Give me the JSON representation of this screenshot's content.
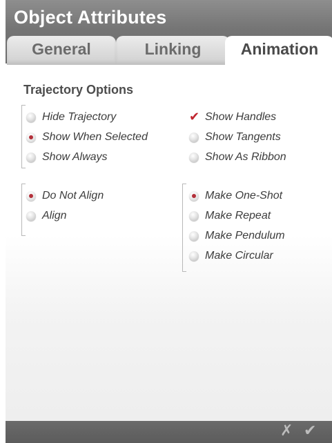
{
  "window": {
    "title": "Object Attributes"
  },
  "tabs": [
    {
      "label": "General",
      "active": false
    },
    {
      "label": "Linking",
      "active": false
    },
    {
      "label": "Animation",
      "active": true
    }
  ],
  "section": {
    "title": "Trajectory Options"
  },
  "trajectory_visibility": {
    "options": [
      {
        "label": "Hide Trajectory",
        "selected": false
      },
      {
        "label": "Show When Selected",
        "selected": true
      },
      {
        "label": "Show Always",
        "selected": false
      }
    ]
  },
  "trajectory_display": {
    "options": [
      {
        "label": "Show Handles",
        "checked": true
      },
      {
        "label": "Show Tangents",
        "checked": false
      },
      {
        "label": "Show As Ribbon",
        "checked": false
      }
    ]
  },
  "alignment": {
    "options": [
      {
        "label": "Do Not Align",
        "selected": true
      },
      {
        "label": "Align",
        "selected": false
      }
    ]
  },
  "playback": {
    "options": [
      {
        "label": "Make One-Shot",
        "selected": true
      },
      {
        "label": "Make Repeat",
        "selected": false
      },
      {
        "label": "Make Pendulum",
        "selected": false
      },
      {
        "label": "Make Circular",
        "selected": false
      }
    ]
  },
  "footer": {
    "cancel_glyph": "✗",
    "ok_glyph": "✔"
  },
  "colors": {
    "header": "#757575",
    "accent_red": "#b3303a",
    "check_red": "#c0252f"
  }
}
